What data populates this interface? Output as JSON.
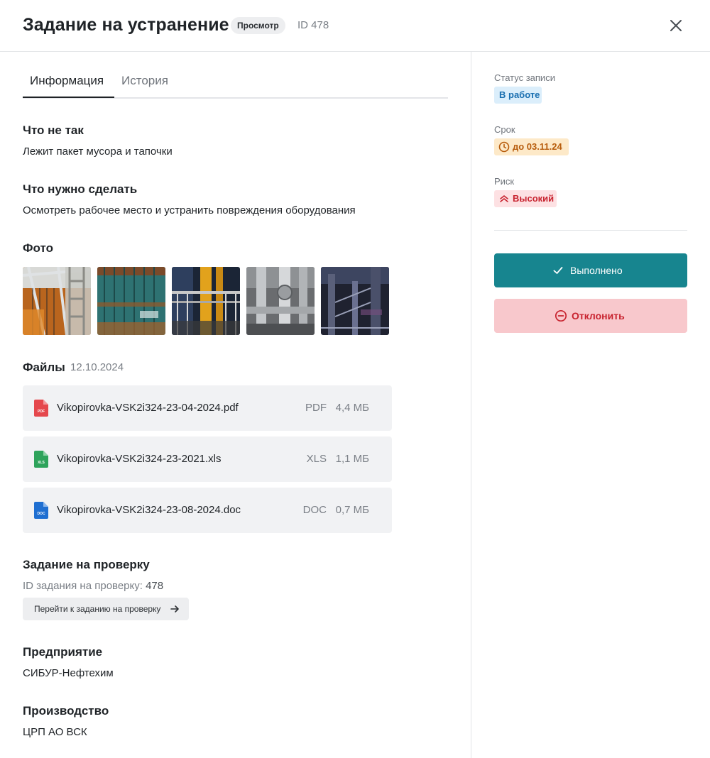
{
  "header": {
    "title": "Задание на устранение",
    "mode_badge": "Просмотр",
    "id_label": "ID 478"
  },
  "tabs": [
    {
      "label": "Информация",
      "active": true
    },
    {
      "label": "История",
      "active": false
    }
  ],
  "sections": {
    "what_wrong": {
      "title": "Что не так",
      "text": "Лежит пакет мусора и тапочки"
    },
    "what_to_do": {
      "title": "Что нужно сделать",
      "text": "Осмотреть рабочее место и устранить повреждения оборудования"
    },
    "photos": {
      "title": "Фото"
    },
    "files": {
      "title": "Файлы",
      "date": "12.10.2024",
      "items": [
        {
          "name": "Vikopirovka-VSK2i324-23-04-2024.pdf",
          "type": "PDF",
          "size": "4,4 МБ",
          "icon": "pdf-file-icon",
          "icon_color": "#e5484d",
          "icon_text": "PDF"
        },
        {
          "name": "Vikopirovka-VSK2i324-23-2021.xls",
          "type": "XLS",
          "size": "1,1 МБ",
          "icon": "xls-file-icon",
          "icon_color": "#2ea35b",
          "icon_text": "XLS"
        },
        {
          "name": "Vikopirovka-VSK2i324-23-08-2024.doc",
          "type": "DOC",
          "size": "0,7 МБ",
          "icon": "doc-file-icon",
          "icon_color": "#1f6fd1",
          "icon_text": "DOC"
        }
      ]
    },
    "check_task": {
      "title": "Задание на проверку",
      "id_label": "ID задания на проверку:",
      "id_value": "478",
      "button_label": "Перейти к заданию на проверку"
    },
    "enterprise": {
      "title": "Предприятие",
      "text": "СИБУР-Нефтехим"
    },
    "production": {
      "title": "Производство",
      "text": "ЦРП АО ВСК"
    }
  },
  "sidebar": {
    "status": {
      "label": "Статус записи",
      "value": "В работе",
      "color": "#1a6fb0"
    },
    "deadline": {
      "label": "Срок",
      "value": "до 03.11.24",
      "icon": "clock-icon",
      "color": "#b75c0c"
    },
    "risk": {
      "label": "Риск",
      "value": "Высокий",
      "icon": "chevrons-up-icon",
      "color": "#c8232f"
    },
    "done_button": "Выполнено",
    "reject_button": "Отклонить"
  },
  "colors": {
    "accent": "#17858f",
    "danger_bg": "#f8c8cc",
    "danger_text": "#c8232f"
  }
}
